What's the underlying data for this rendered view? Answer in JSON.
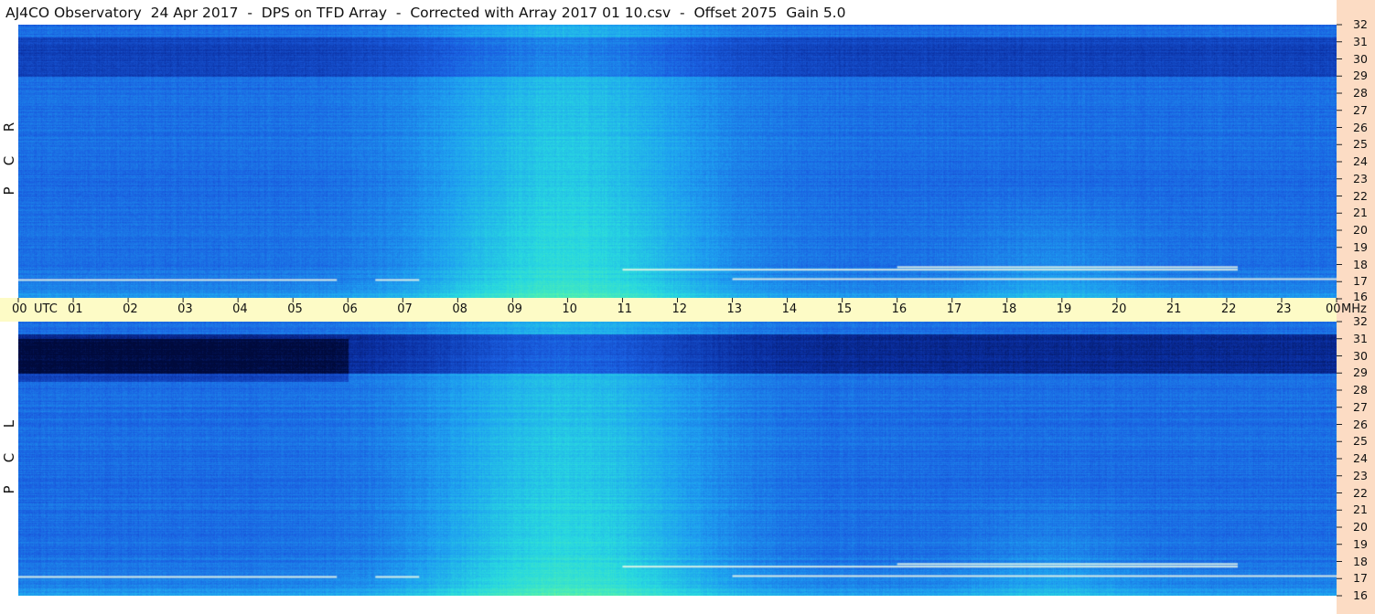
{
  "title": "AJ4CO Observatory  24 Apr 2017  -  DPS on TFD Array  -  Corrected with Array 2017 01 10.csv  -  Offset 2075  Gain 5.0",
  "chart_data": {
    "type": "heatmap",
    "title": "AJ4CO Observatory  24 Apr 2017  -  DPS on TFD Array  -  Corrected with Array 2017 01 10.csv  -  Offset 2075  Gain 5.0",
    "x_axis": {
      "unit_label": "UTC",
      "range": [
        0,
        24
      ],
      "ticks": [
        "00",
        "01",
        "02",
        "03",
        "04",
        "05",
        "06",
        "07",
        "08",
        "09",
        "10",
        "11",
        "12",
        "13",
        "14",
        "15",
        "16",
        "17",
        "18",
        "19",
        "20",
        "21",
        "22",
        "23",
        "00"
      ]
    },
    "y_axis": {
      "unit_label": "MHz",
      "range": [
        16,
        32
      ],
      "ticks": [
        "16",
        "17",
        "18",
        "19",
        "20",
        "21",
        "22",
        "23",
        "24",
        "25",
        "26",
        "27",
        "28",
        "29",
        "30",
        "31",
        "32"
      ]
    },
    "panels": [
      {
        "name": "RCP",
        "letters": [
          "R",
          "C",
          "P"
        ]
      },
      {
        "name": "LCP",
        "letters": [
          "L",
          "C",
          "P"
        ]
      }
    ],
    "colormap": [
      "#000a3c",
      "#0a2ea0",
      "#1a5ee0",
      "#1e9ff0",
      "#28d8e0",
      "#50f0b0",
      "#b8f060",
      "#ffffff"
    ],
    "colors": {
      "time_bar": "#fdfbc6",
      "freq_strip": "#fcdcc4"
    }
  }
}
